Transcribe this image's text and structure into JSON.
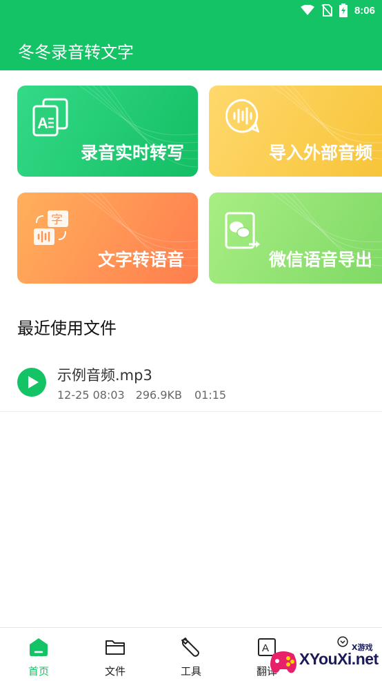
{
  "status_bar": {
    "time": "8:06"
  },
  "app": {
    "title": "冬冬录音转文字"
  },
  "cards": [
    {
      "label": "录音实时转写",
      "icon": "text-document-icon"
    },
    {
      "label": "导入外部音频",
      "icon": "voice-bubble-icon"
    },
    {
      "label": "文字转语音",
      "icon": "text-to-speech-icon"
    },
    {
      "label": "微信语音导出",
      "icon": "wechat-export-icon"
    }
  ],
  "recent": {
    "title": "最近使用文件",
    "files": [
      {
        "name": "示例音频.mp3",
        "date": "12-25 08:03",
        "size": "296.9KB",
        "duration": "01:15"
      }
    ]
  },
  "nav": {
    "items": [
      {
        "label": "首页",
        "icon": "home-icon",
        "active": true
      },
      {
        "label": "文件",
        "icon": "folder-icon",
        "active": false
      },
      {
        "label": "工具",
        "icon": "wrench-icon",
        "active": false
      },
      {
        "label": "翻译",
        "icon": "translate-icon",
        "active": false
      },
      {
        "label": "",
        "icon": "more-icon",
        "active": false
      }
    ]
  },
  "watermark": {
    "text": "XYouXi.net",
    "small": "X游戏"
  },
  "colors": {
    "primary": "#13C366",
    "card_green": "#14BE64",
    "card_yellow": "#F7C437",
    "card_orange": "#FF7D4E",
    "card_lightgreen": "#7ED864"
  }
}
